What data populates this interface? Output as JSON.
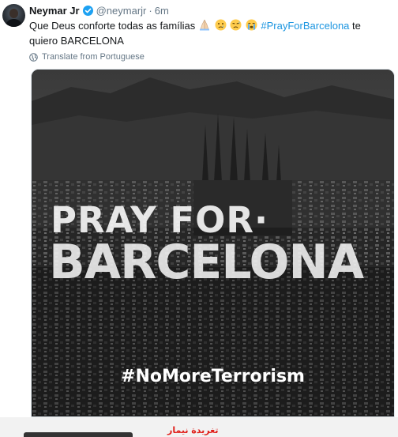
{
  "tweet": {
    "author_name": "Neymar Jr",
    "handle": "@neymarjr",
    "separator": "·",
    "time": "6m",
    "text_line1_start": "Que Deus conforte todas as famílias",
    "hashtag": "#PrayForBarcelona",
    "text_line1_end": "te",
    "text_line2": "quiero BARCELONA",
    "emojis": [
      "folded-hands-emoji",
      "crying-face-emoji",
      "disappointed-relieved-emoji",
      "loudly-crying-face-emoji"
    ],
    "translate_label": "Translate from Portuguese"
  },
  "media": {
    "line1": "PRAY FOR·",
    "line2": "BARCELONA",
    "hashtag": "#NoMoreTerrorism"
  },
  "footer": {
    "caption": "تغريدة نيمار"
  },
  "colors": {
    "link": "#1b95e0",
    "verified": "#1da1f2",
    "muted": "#657786",
    "caption": "#e0201b"
  }
}
